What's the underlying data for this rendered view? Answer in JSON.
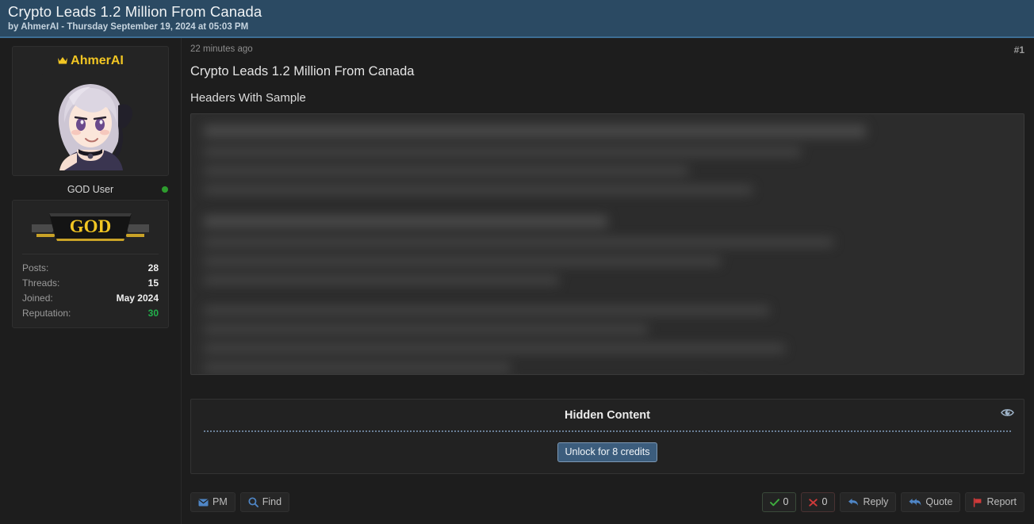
{
  "thread": {
    "title": "Crypto Leads 1.2 Million From Canada",
    "byline": "by AhmerAI - Thursday September 19, 2024 at 05:03 PM"
  },
  "sidebar": {
    "username": "AhmerAI",
    "crown_icon": "crown-icon",
    "avatar_icon": "user-avatar",
    "usergroup": "GOD User",
    "online_status": "online",
    "rank_badge_text": "GOD",
    "stats": [
      {
        "label": "Posts:",
        "value": "28",
        "type": "normal"
      },
      {
        "label": "Threads:",
        "value": "15",
        "type": "normal"
      },
      {
        "label": "Joined:",
        "value": "May 2024",
        "type": "normal"
      },
      {
        "label": "Reputation:",
        "value": "30",
        "type": "reputation"
      }
    ]
  },
  "post": {
    "time": "22 minutes ago",
    "number": "#1",
    "title": "Crypto Leads 1.2 Million From Canada",
    "subtitle": "Headers With Sample",
    "content_state": "blurred"
  },
  "hidden_content": {
    "title": "Hidden Content",
    "eye_icon": "eye-icon",
    "unlock_label": "Unlock for 8 credits"
  },
  "footer": {
    "left_buttons": [
      {
        "label": "PM",
        "icon": "envelope-icon"
      },
      {
        "label": "Find",
        "icon": "search-icon"
      }
    ],
    "votes": [
      {
        "label": "0",
        "icon": "check-icon",
        "kind": "up"
      },
      {
        "label": "0",
        "icon": "x-icon",
        "kind": "down"
      }
    ],
    "right_buttons": [
      {
        "label": "Reply",
        "icon": "reply-arrow-icon"
      },
      {
        "label": "Quote",
        "icon": "quote-arrows-icon"
      },
      {
        "label": "Report",
        "icon": "flag-icon"
      }
    ]
  },
  "colors": {
    "header_bg": "#2b4a63",
    "header_border": "#3d6d94",
    "page_bg": "#1d1d1d",
    "username_gold": "#f2c623",
    "reputation_green": "#22b14c",
    "online_green": "#2e9c2e",
    "unlock_blue": "#3c5d7d",
    "report_red": "#d03a3a",
    "link_blue": "#5b8fc9"
  }
}
